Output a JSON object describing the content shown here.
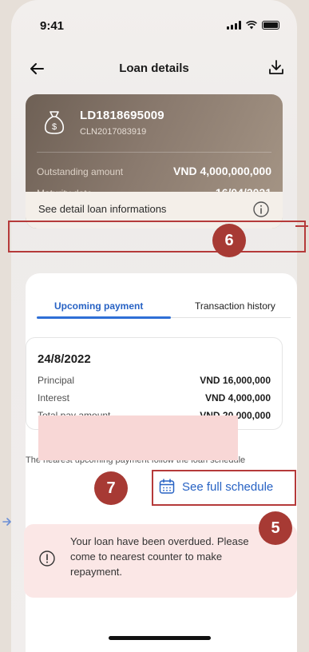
{
  "status": {
    "time": "9:41"
  },
  "header": {
    "title": "Loan details"
  },
  "loan": {
    "id": "LD1818695009",
    "cln": "CLN2017083919",
    "outstanding_label": "Outstanding amount",
    "outstanding_value": "VND 4,000,000,000",
    "maturity_label": "Maturity date",
    "maturity_value": "16/04/2021",
    "detail_label": "See detail loan informations"
  },
  "tabs": [
    {
      "label": "Upcoming payment",
      "active": true
    },
    {
      "label": "Transaction history",
      "active": false
    }
  ],
  "payment": {
    "date": "24/8/2022",
    "rows": [
      {
        "label": "Principal",
        "value": "VND 16,000,000"
      },
      {
        "label": "Interest",
        "value": "VND 4,000,000"
      },
      {
        "label": "Total pay amount",
        "value": "VND 20,000,000"
      }
    ]
  },
  "note": "The nearest upcoming payment follow the loan schedule",
  "schedule": {
    "label": "See full schedule"
  },
  "overdue": {
    "text": "Your loan have been overdued. Please come to nearest counter to make repayment."
  },
  "annotations": {
    "badge5": "5",
    "badge6": "6",
    "badge7": "7"
  },
  "colors": {
    "accent": "#2762c4",
    "annotation": "#a73a34",
    "card_brown": "#8a7a6e",
    "overdue_bg": "#fbe7e6"
  },
  "icons": [
    "back-arrow-icon",
    "download-icon",
    "money-bag-icon",
    "info-icon",
    "calendar-icon",
    "warning-icon"
  ]
}
